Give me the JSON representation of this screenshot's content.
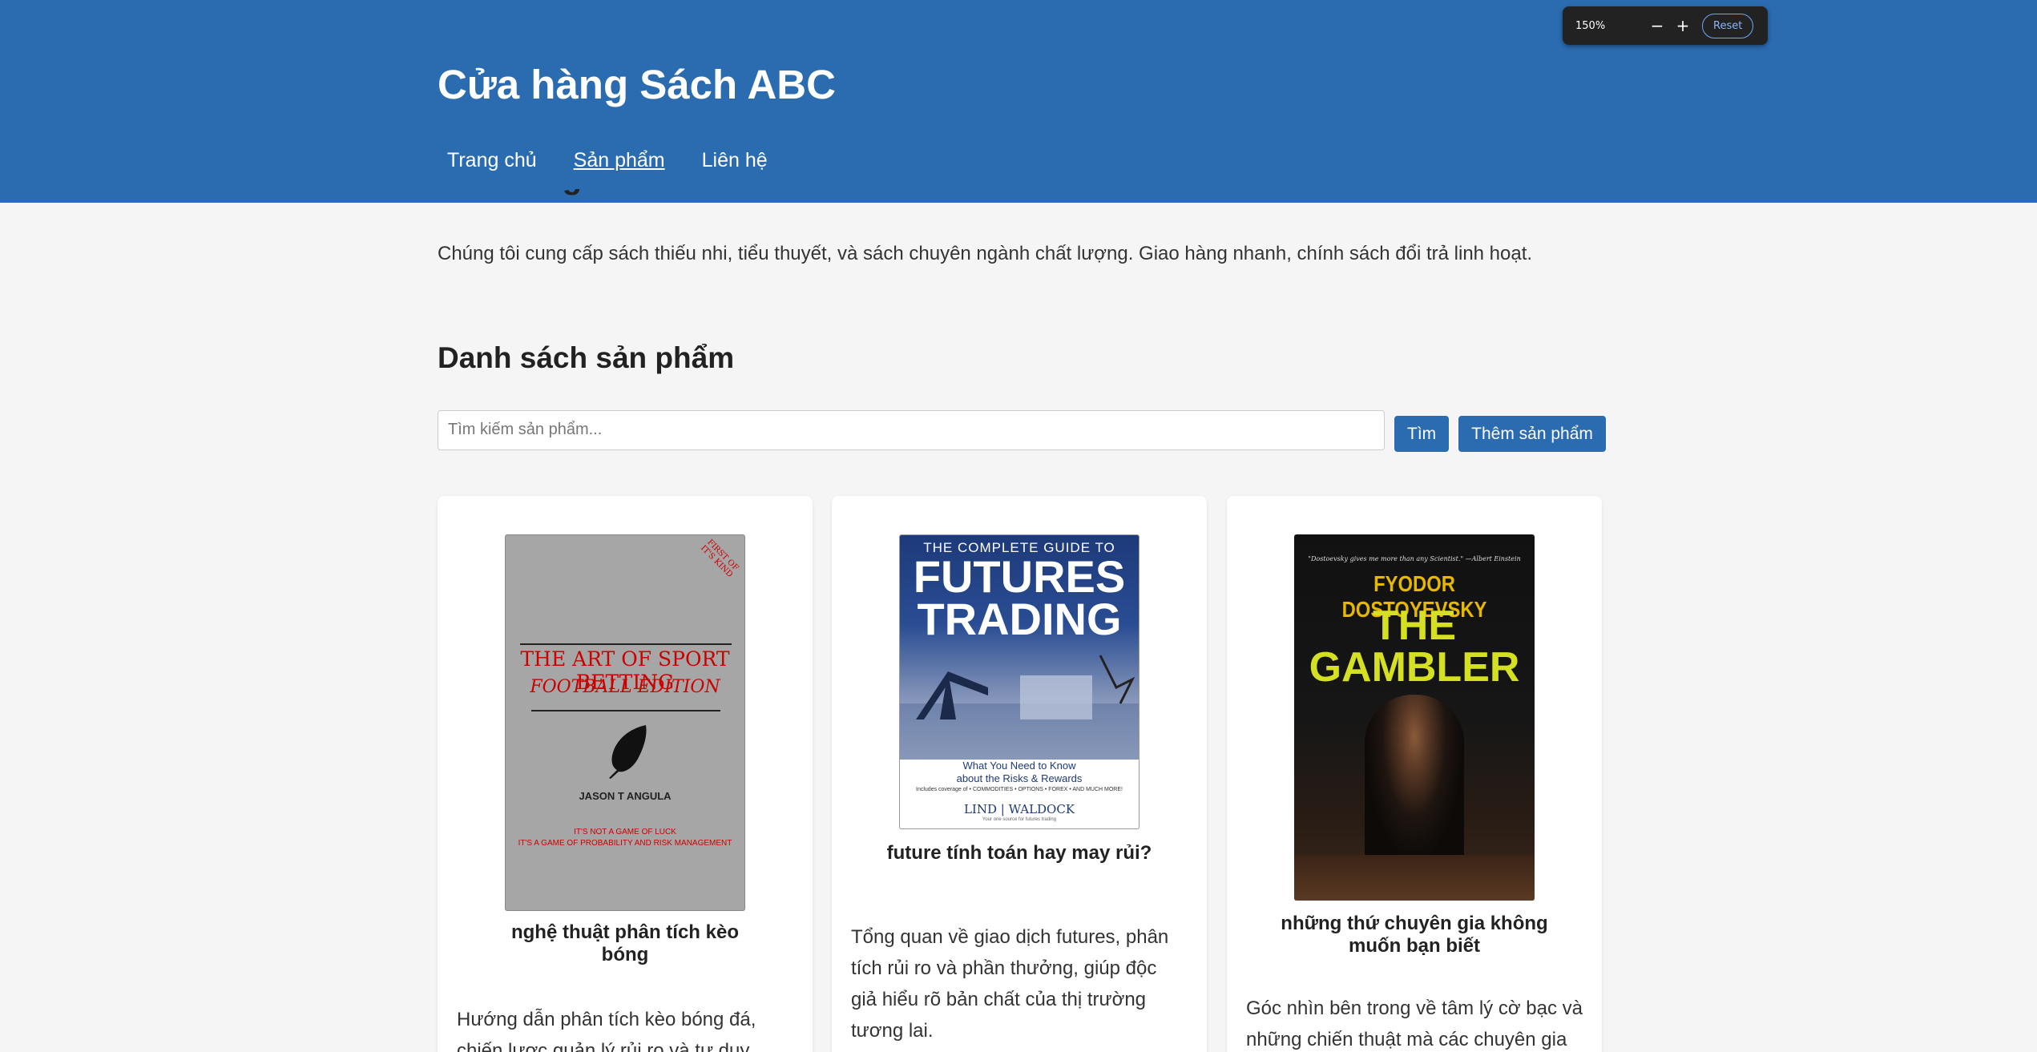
{
  "site": {
    "title": "Cửa hàng Sách ABC"
  },
  "nav": {
    "items": [
      "Trang chủ",
      "Sản phẩm",
      "Liên hệ"
    ]
  },
  "zoom": {
    "level": "150%",
    "minus": "−",
    "plus": "+",
    "reset": "Reset"
  },
  "intro": {
    "partial_heading": "Về chúng tôi",
    "text": "Chúng tôi cung cấp sách thiếu nhi, tiểu thuyết, và sách chuyên ngành chất lượng. Giao hàng nhanh, chính sách đổi trả linh hoạt."
  },
  "products": {
    "heading": "Danh sách sản phẩm",
    "search_placeholder": "Tìm kiếm sản phẩm...",
    "search_button": "Tìm",
    "add_button": "Thêm sản phẩm",
    "items": [
      {
        "title": "nghệ thuật phân tích kèo bóng",
        "description": "Hướng dẫn phân tích kèo bóng đá, chiến lược quản lý rủi ro và tư duy",
        "cover": {
          "ribbon": "FIRST OF IT'S KIND",
          "line1": "THE ART OF SPORT BETTING",
          "line2": "FOOTBALL EDITION",
          "author": "JASON T ANGULA",
          "tag1": "IT'S NOT A GAME OF LUCK",
          "tag2": "IT'S A GAME OF PROBABILITY AND RISK MANAGEMENT"
        }
      },
      {
        "title": "future tính toán hay may rủi?",
        "description": "Tổng quan về giao dịch futures, phân tích rủi ro và phần thưởng, giúp độc giả hiểu rõ bản chất của thị trường tương lai.",
        "cover": {
          "sub": "THE COMPLETE GUIDE TO",
          "big1": "FUTURES",
          "big2": "TRADING",
          "what1": "What You Need to Know",
          "what2": "about the Risks & Rewards",
          "includes": "Includes coverage of  • COMMODITIES  • OPTIONS  • FOREX  • AND MUCH MORE!",
          "publisher": "LIND | WALDOCK",
          "publisher_tag": "Your one source for futures trading"
        }
      },
      {
        "title": "những thứ chuyên gia không muốn bạn biết",
        "description": "Góc nhìn bên trong về tâm lý cờ bạc và những chiến thuật mà các chuyên gia",
        "cover": {
          "quote": "\"Dostoevsky gives me more than any Scientist.\" —Albert Einstein",
          "author": "FYODOR DOSTOYEVSKY",
          "the": "THE",
          "gambler": "GAMBLER"
        }
      }
    ]
  },
  "colors": {
    "header_bg": "#2b6cb0",
    "page_bg": "#f5f5f5",
    "button_bg": "#2b6cb0"
  }
}
